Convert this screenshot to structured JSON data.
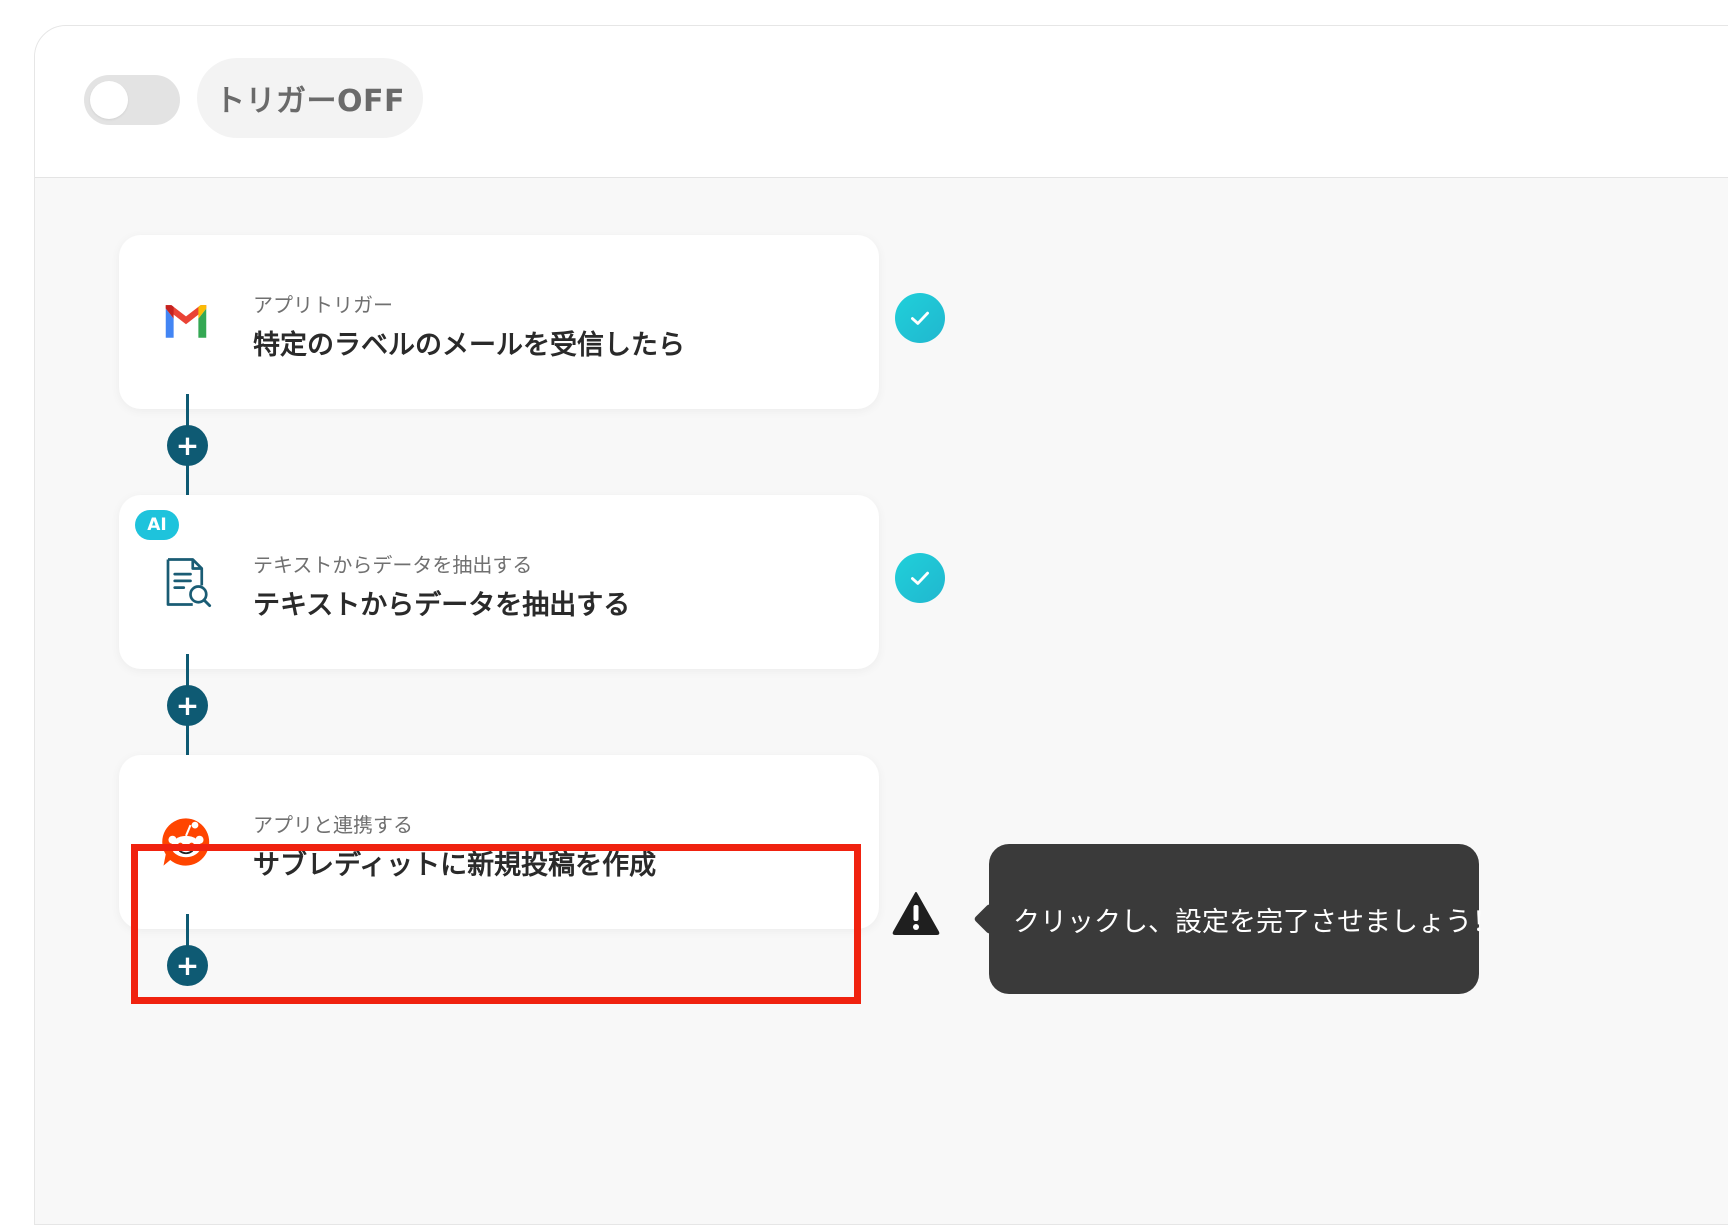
{
  "header": {
    "trigger_toggle_state": "off",
    "trigger_label": "トリガーOFF"
  },
  "steps": [
    {
      "subtitle": "アプリトリガー",
      "title": "特定のラベルのメールを受信したら",
      "icon": "gmail-icon",
      "status": "complete"
    },
    {
      "badge": "AI",
      "subtitle": "テキストからデータを抽出する",
      "title": "テキストからデータを抽出する",
      "icon": "document-search-icon",
      "status": "complete"
    },
    {
      "subtitle": "アプリと連携する",
      "title": "サブレディットに新規投稿を作成",
      "icon": "reddit-icon",
      "status": "warning"
    }
  ],
  "tooltip": {
    "text": "クリックし、設定を完了させましょう！"
  },
  "colors": {
    "connector": "#0e5a73",
    "check": "#1ec3dc",
    "highlight": "#f0220f",
    "tooltip_bg": "#3a3a3a",
    "reddit": "#ff4500"
  }
}
